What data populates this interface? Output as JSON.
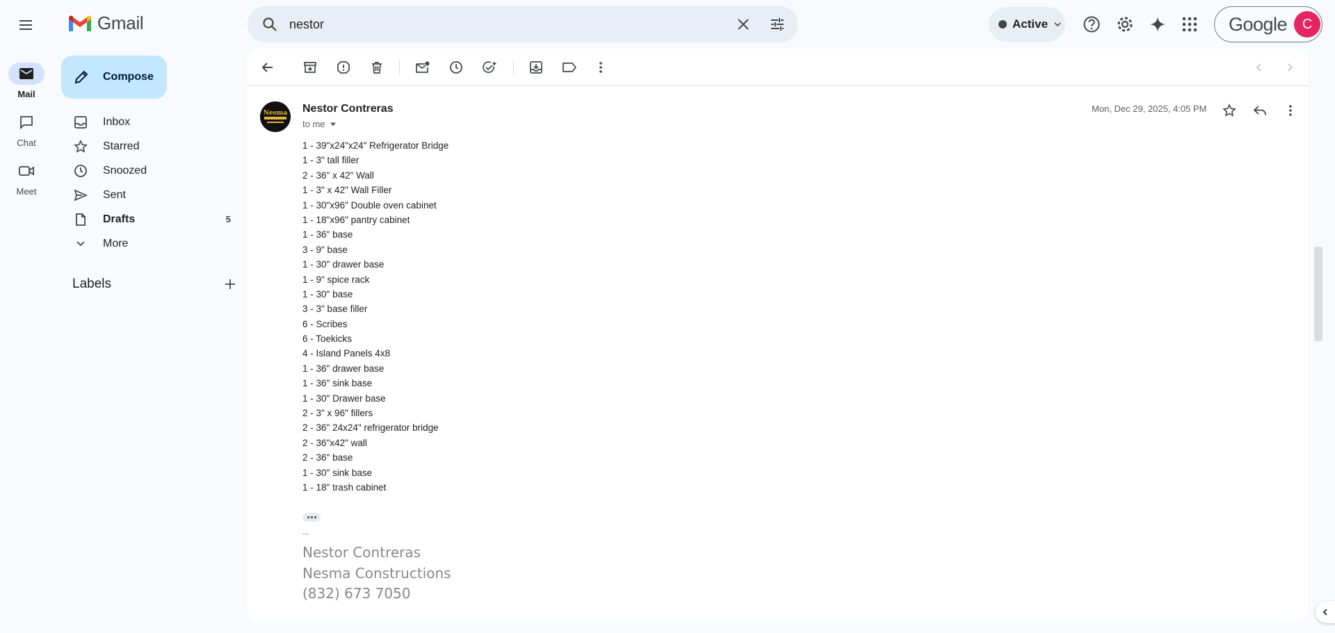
{
  "app": {
    "name": "Gmail"
  },
  "search": {
    "query": "nestor"
  },
  "status": {
    "label": "Active"
  },
  "account": {
    "brand": "Google",
    "avatar_letter": "C"
  },
  "rail": [
    {
      "label": "Mail"
    },
    {
      "label": "Chat"
    },
    {
      "label": "Meet"
    }
  ],
  "compose": {
    "label": "Compose"
  },
  "nav": [
    {
      "label": "Inbox"
    },
    {
      "label": "Starred"
    },
    {
      "label": "Snoozed"
    },
    {
      "label": "Sent"
    },
    {
      "label": "Drafts",
      "count": "5"
    },
    {
      "label": "More"
    }
  ],
  "labels": {
    "title": "Labels"
  },
  "message": {
    "sender": "Nestor Contreras",
    "to": "to me",
    "date": "Mon, Dec 29, 2025, 4:05 PM",
    "avatar_text": "Nesma",
    "lines": [
      "1 - 39\"x24\"x24\" Refrigerator Bridge",
      "1 - 3\" tall filler",
      "2 - 36\" x 42\" Wall",
      "1 - 3\" x 42\" Wall Filler",
      "1 - 30\"x96\" Double oven cabinet",
      "1 - 18\"x96\" pantry cabinet",
      "1 - 36\" base",
      "3 - 9\" base",
      "1 - 30\" drawer base",
      "1 - 9\" spice rack",
      "1 - 30\" base",
      "3 - 3\" base filler",
      "6 - Scribes",
      "6 - Toekicks",
      "4 - Island Panels 4x8",
      "1 - 36\" drawer base",
      "1 - 36\" sink base",
      "1 - 30\" Drawer base",
      "2 - 3\" x 96\" fillers",
      "2 - 36\" 24x24\" refrigerator bridge",
      "2 - 36\"x42\" wall",
      "2 - 36\" base",
      "1 - 30\" sink base",
      "1 - 18\" trash cabinet"
    ],
    "signature": {
      "dash": "--",
      "name": "Nestor Contreras",
      "company": "Nesma Constructions",
      "phone": "(832) 673 7050"
    }
  },
  "colors": {
    "compose_bg": "#c2e7ff",
    "rail_active": "#d3e3fd",
    "avatar": "#e52562",
    "search_bg": "#e9eef6"
  }
}
